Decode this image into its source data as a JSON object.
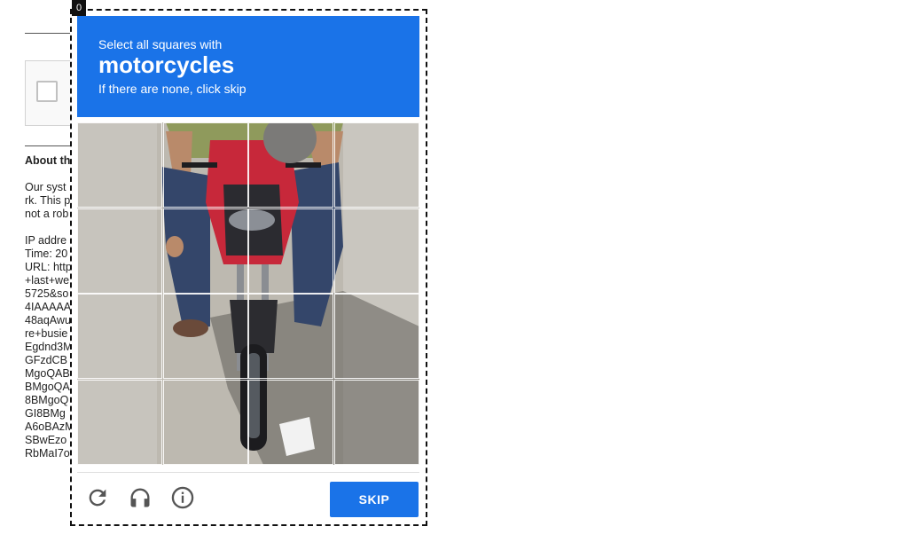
{
  "overlay_badge": "0",
  "background_page": {
    "heading": "About th",
    "paragraph_lines": [
      "Our syst",
      "rk. This p",
      "not a rob"
    ],
    "detail_lines": [
      "IP addre",
      "Time: 20",
      "URL: http",
      "+last+we",
      "5725&so",
      "4IAAAAA",
      "48aqAwu",
      "re+busie",
      "Egdnd3M",
      "GFzdCB",
      "MgoQAB",
      "BMgoQA",
      "8BMgoQ",
      "GI8BMg",
      "A6oBAzM",
      "SBwEzo",
      "RbMaI7o"
    ]
  },
  "challenge": {
    "instruction": "Select all squares with",
    "target": "motorcycles",
    "hint": "If there are none, click skip",
    "grid_rows": 4,
    "grid_cols": 4,
    "skip_label": "SKIP",
    "icons": [
      "reload-icon",
      "headphones-icon",
      "info-icon"
    ],
    "colors": {
      "header_blue": "#1a73e8",
      "button_blue": "#1a73e8",
      "icon_gray": "#555555"
    }
  }
}
